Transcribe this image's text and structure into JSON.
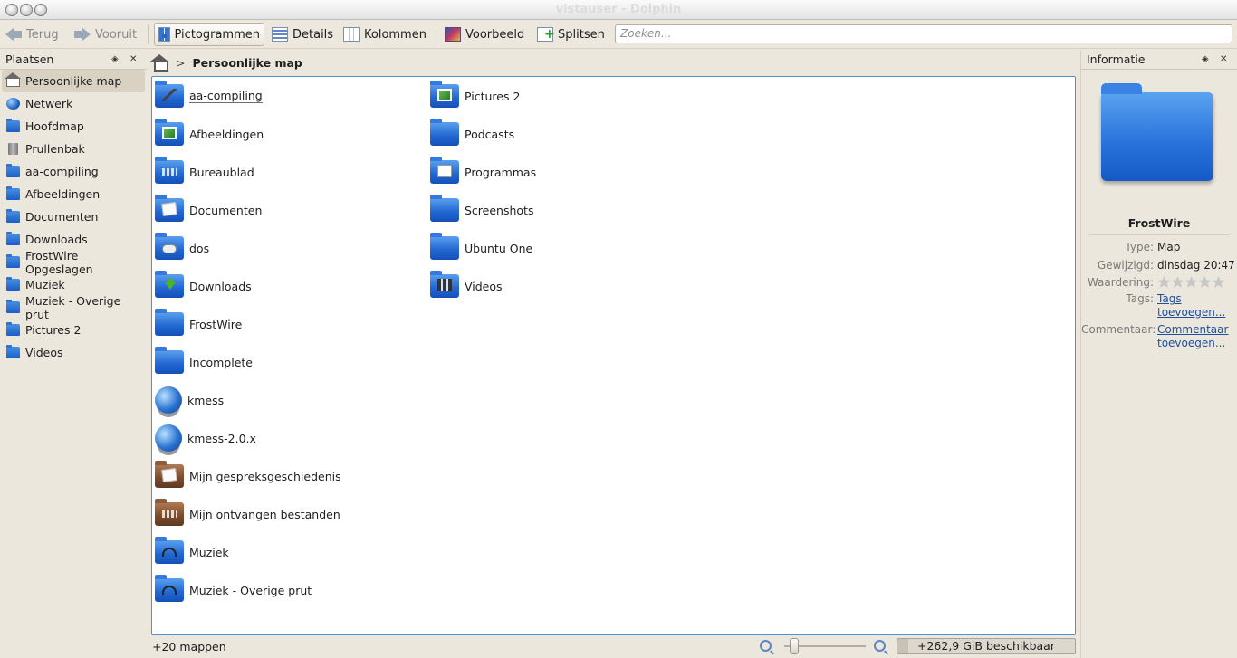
{
  "window": {
    "title": "vistauser - Dolphin"
  },
  "toolbar": {
    "back_label": "Terug",
    "forward_label": "Vooruit",
    "icons_label": "Pictogrammen",
    "details_label": "Details",
    "columns_label": "Kolommen",
    "preview_label": "Voorbeeld",
    "split_label": "Splitsen",
    "search_placeholder": "Zoeken..."
  },
  "places": {
    "title": "Plaatsen",
    "items": [
      {
        "label": "Persoonlijke map",
        "icon": "home-icon",
        "selected": true
      },
      {
        "label": "Netwerk",
        "icon": "globe-icon"
      },
      {
        "label": "Hoofdmap",
        "icon": "folder-icon"
      },
      {
        "label": "Prullenbak",
        "icon": "trash-icon"
      },
      {
        "label": "aa-compiling",
        "icon": "folder-icon"
      },
      {
        "label": "Afbeeldingen",
        "icon": "folder-icon"
      },
      {
        "label": "Documenten",
        "icon": "folder-icon"
      },
      {
        "label": "Downloads",
        "icon": "folder-icon"
      },
      {
        "label": "FrostWire Opgeslagen",
        "icon": "folder-icon"
      },
      {
        "label": "Muziek",
        "icon": "folder-icon"
      },
      {
        "label": "Muziek - Overige prut",
        "icon": "folder-icon"
      },
      {
        "label": "Pictures 2",
        "icon": "folder-icon"
      },
      {
        "label": "Videos",
        "icon": "folder-icon"
      }
    ]
  },
  "breadcrumb": {
    "current": "Persoonlijke map"
  },
  "files": [
    {
      "name": "aa-compiling",
      "emblem": "tool"
    },
    {
      "name": "Afbeeldingen",
      "emblem": "img"
    },
    {
      "name": "Bureaublad",
      "emblem": "desk"
    },
    {
      "name": "Documenten",
      "emblem": "paper"
    },
    {
      "name": "dos",
      "emblem": "game"
    },
    {
      "name": "Downloads",
      "emblem": "dl"
    },
    {
      "name": "FrostWire",
      "emblem": ""
    },
    {
      "name": "Incomplete",
      "emblem": ""
    },
    {
      "name": "kmess",
      "emblem": "globe"
    },
    {
      "name": "kmess-2.0.x",
      "emblem": "globe"
    },
    {
      "name": "Mijn gespreksgeschiedenis",
      "emblem": "paper-brown"
    },
    {
      "name": "Mijn ontvangen bestanden",
      "emblem": "desk-brown"
    },
    {
      "name": "Muziek",
      "emblem": "music"
    },
    {
      "name": "Muziek - Overige prut",
      "emblem": "music"
    },
    {
      "name": "Pictures 2",
      "emblem": "img"
    },
    {
      "name": "Podcasts",
      "emblem": ""
    },
    {
      "name": "Programmas",
      "emblem": "app"
    },
    {
      "name": "Screenshots",
      "emblem": ""
    },
    {
      "name": "Ubuntu One",
      "emblem": ""
    },
    {
      "name": "Videos",
      "emblem": "film"
    }
  ],
  "info": {
    "title": "Informatie",
    "name": "FrostWire",
    "type_label": "Type:",
    "type_value": "Map",
    "modified_label": "Gewijzigd:",
    "modified_value": "dinsdag 20:47",
    "rating_label": "Waardering:",
    "rating_value": 0,
    "tags_label": "Tags:",
    "tags_link": "Tags toevoegen...",
    "comment_label": "Commentaar:",
    "comment_link": "Commentaar toevoegen..."
  },
  "status": {
    "summary": "+20 mappen",
    "free_space": "+262,9 GiB beschikbaar"
  }
}
